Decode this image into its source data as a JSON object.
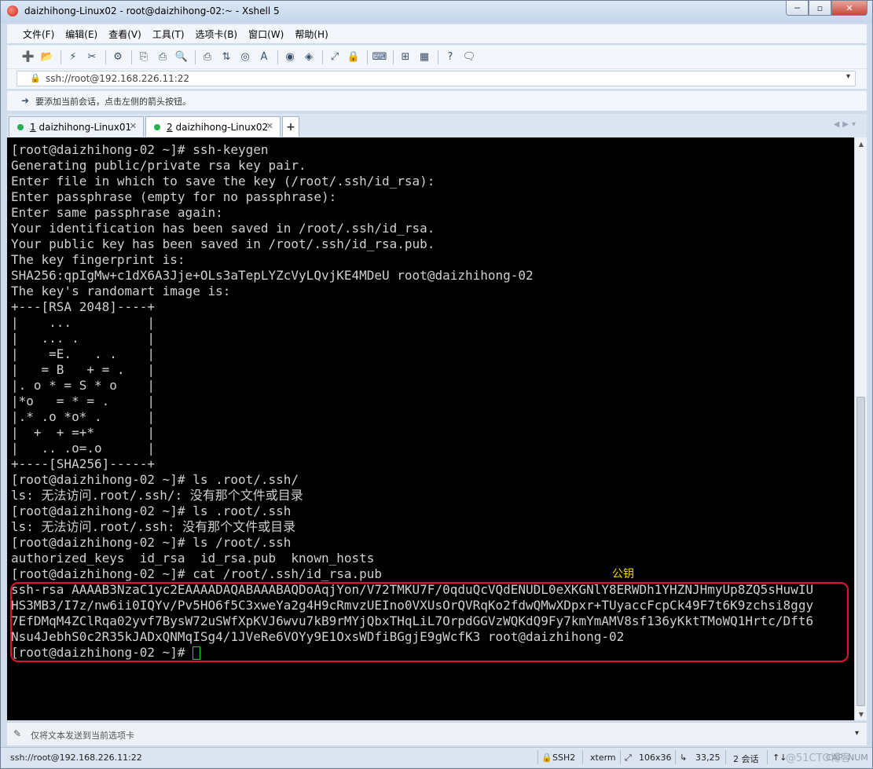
{
  "window": {
    "title": "daizhihong-Linux02 - root@daizhihong-02:~ - Xshell 5",
    "controls": {
      "minimize": "─",
      "maximize": "▫",
      "close": "✕"
    }
  },
  "menu": [
    "文件(F)",
    "编辑(E)",
    "查看(V)",
    "工具(T)",
    "选项卡(B)",
    "窗口(W)",
    "帮助(H)"
  ],
  "toolbar_icons": [
    "new-session",
    "open-folder",
    "connect",
    "disconnect",
    "properties",
    "copy",
    "paste",
    "find",
    "print",
    "transfer",
    "globe",
    "font",
    "xftp",
    "xagent",
    "fullscreen",
    "lock",
    "keyboard",
    "add-tab",
    "layout",
    "help",
    "chat"
  ],
  "address": {
    "value": "ssh://root@192.168.226.11:22"
  },
  "hint": {
    "text": "要添加当前会话，点击左侧的箭头按钮。"
  },
  "tabs": [
    {
      "num": "1",
      "label": "daizhihong-Linux01",
      "active": false
    },
    {
      "num": "2",
      "label": "daizhihong-Linux02",
      "active": true
    }
  ],
  "terminal": {
    "lines": [
      "[root@daizhihong-02 ~]# ssh-keygen",
      "Generating public/private rsa key pair.",
      "Enter file in which to save the key (/root/.ssh/id_rsa):",
      "Enter passphrase (empty for no passphrase):",
      "Enter same passphrase again:",
      "Your identification has been saved in /root/.ssh/id_rsa.",
      "Your public key has been saved in /root/.ssh/id_rsa.pub.",
      "The key fingerprint is:",
      "SHA256:qpIgMw+c1dX6A3Jje+OLs3aTepLYZcVyLQvjKE4MDeU root@daizhihong-02",
      "The key's randomart image is:",
      "+---[RSA 2048]----+",
      "|    ...          |",
      "|   ... .         |",
      "|    =E.   . .    |",
      "|   = B   + = .   |",
      "|. o * = S * o    |",
      "|*o   = * = .     |",
      "|.* .o *o* .      |",
      "|  +  + =+*       |",
      "|   .. .o=.o      |",
      "+----[SHA256]-----+",
      "[root@daizhihong-02 ~]# ls .root/.ssh/",
      "ls: 无法访问.root/.ssh/: 没有那个文件或目录",
      "[root@daizhihong-02 ~]# ls .root/.ssh",
      "ls: 无法访问.root/.ssh: 没有那个文件或目录",
      "[root@daizhihong-02 ~]# ls /root/.ssh",
      "authorized_keys  id_rsa  id_rsa.pub  known_hosts",
      "[root@daizhihong-02 ~]# cat /root/.ssh/id_rsa.pub",
      "ssh-rsa AAAAB3NzaC1yc2EAAAADAQABAAABAQDoAqjYon/V72TMKU7F/0qduQcVQdENUDL0eXKGNlY8ERWDh1YHZNJHmyUp8ZQ5sHuwIU",
      "HS3MB3/I7z/nw6ii0IQYv/Pv5HO6f5C3xweYa2g4H9cRmvzUEIno0VXUsOrQVRqKo2fdwQMwXDpxr+TUyaccFcpCk49F7t6K9zchsi8ggy",
      "7EfDMqM4ZClRqa02yvf7BysW72uSWfXpKVJ6wvu7kB9rMYjQbxTHqLiL7OrpdGGVzWQKdQ9Fy7kmYmAMV8sf136yKktTMoWQ1Hrtc/Dft6",
      "Nsu4JebhS0c2R35kJADxQNMqISg4/1JVeRe6VOYy9E1OxsWDfiBGgjE9gWcfK3 root@daizhihong-02",
      "[root@daizhihong-02 ~]# "
    ],
    "annotation": "公钥"
  },
  "sendbar": {
    "text": "仅将文本发送到当前选项卡"
  },
  "status": {
    "connection": "ssh://root@192.168.226.11:22",
    "protocol": "SSH2",
    "term": "xterm",
    "size": "106x36",
    "cursor_pos": "33,25",
    "sessions": "2 会话",
    "caps": "CAP",
    "num": "NUM"
  },
  "watermark": "@51CTO博客",
  "colors": {
    "terminal_bg": "#000000",
    "terminal_fg": "#d0d0d0",
    "highlight_border": "#e2132a",
    "annotation": "#f6d800",
    "cursor": "#1ed12a",
    "tab_dot": "#22b14c"
  }
}
